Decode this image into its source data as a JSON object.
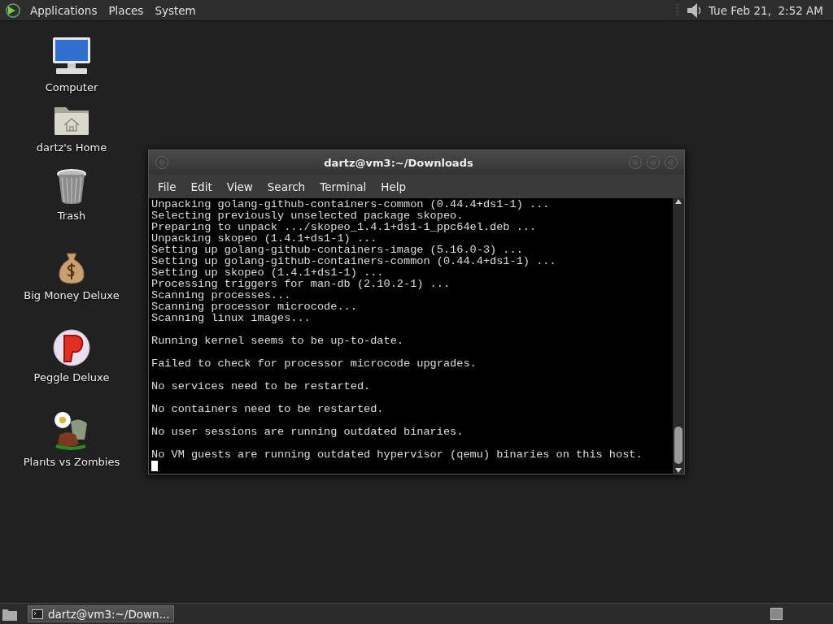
{
  "top_panel": {
    "menus": [
      "Applications",
      "Places",
      "System"
    ],
    "clock": "Tue Feb 21,  2:52 AM"
  },
  "desktop_icons": [
    {
      "label": "Computer",
      "kind": "computer"
    },
    {
      "label": "dartz's Home",
      "kind": "home"
    },
    {
      "label": "Trash",
      "kind": "trash"
    },
    {
      "label": "Big Money Deluxe",
      "kind": "moneybag"
    },
    {
      "label": "Peggle Deluxe",
      "kind": "ball"
    },
    {
      "label": "Plants vs Zombies",
      "kind": "plant"
    }
  ],
  "terminal": {
    "title": "dartz@vm3:~/Downloads",
    "menu": [
      "File",
      "Edit",
      "View",
      "Search",
      "Terminal",
      "Help"
    ],
    "output_blocks": [
      [
        "Unpacking golang-github-containers-common (0.44.4+ds1-1) ...",
        "Selecting previously unselected package skopeo.",
        "Preparing to unpack .../skopeo_1.4.1+ds1-1_ppc64el.deb ...",
        "Unpacking skopeo (1.4.1+ds1-1) ...",
        "Setting up golang-github-containers-image (5.16.0-3) ...",
        "Setting up golang-github-containers-common (0.44.4+ds1-1) ...",
        "Setting up skopeo (1.4.1+ds1-1) ...",
        "Processing triggers for man-db (2.10.2-1) ...",
        "Scanning processes...",
        "Scanning processor microcode...",
        "Scanning linux images..."
      ],
      [
        "Running kernel seems to be up-to-date."
      ],
      [
        "Failed to check for processor microcode upgrades."
      ],
      [
        "No services need to be restarted."
      ],
      [
        "No containers need to be restarted."
      ],
      [
        "No user sessions are running outdated binaries."
      ],
      [
        "No VM guests are running outdated hypervisor (qemu) binaries on this host."
      ]
    ]
  },
  "taskbar": {
    "tasks": [
      {
        "label": "dartz@vm3:~/Down...",
        "selected": true
      }
    ]
  }
}
